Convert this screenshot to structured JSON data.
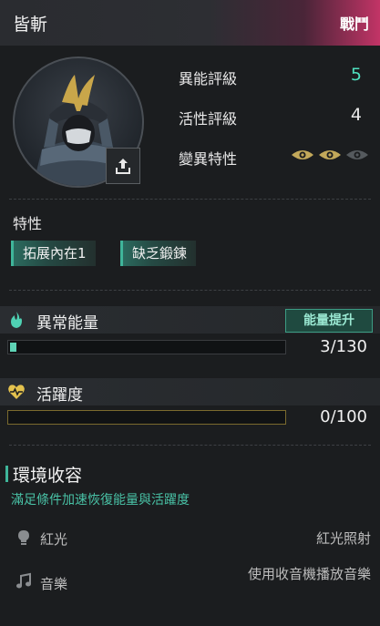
{
  "header": {
    "title": "皆斬",
    "tag": "戰鬥"
  },
  "ratings": [
    {
      "label": "異能評級",
      "value": "5",
      "color": "#4fe0bf"
    },
    {
      "label": "活性評級",
      "value": "4",
      "color": "#e8e8e8"
    },
    {
      "label": "變異特性",
      "icons": [
        "eye-icon",
        "eye-icon",
        "eye-icon"
      ],
      "active_count": 2
    }
  ],
  "traits": {
    "title": "特性",
    "items": [
      "拓展內在1",
      "缺乏鍛鍊"
    ]
  },
  "energy": {
    "label": "異常能量",
    "boost_label": "能量提升",
    "current": 3,
    "max": 130,
    "counter": "3/130"
  },
  "activity": {
    "label": "活躍度",
    "current": 0,
    "max": 100,
    "counter": "0/100"
  },
  "environment": {
    "title": "環境收容",
    "description": "滿足條件加速恢復能量與活躍度",
    "conditions": [
      {
        "name": "紅光",
        "value": "紅光照射",
        "icon": "lightbulb-icon"
      },
      {
        "name": "音樂",
        "value": "使用收音機播放音樂",
        "icon": "music-note-icon"
      }
    ]
  },
  "colors": {
    "accent": "#3fb59a",
    "header_pink": "#c23466"
  }
}
